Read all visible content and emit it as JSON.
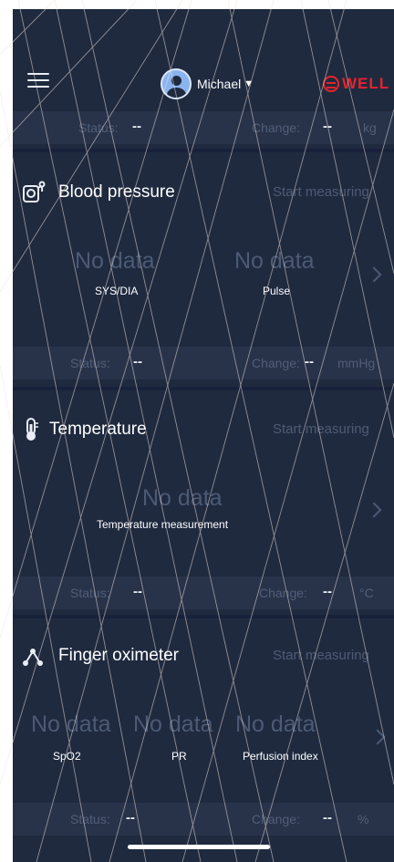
{
  "header": {
    "user_name": "Michael",
    "brand": "WELL",
    "icons": [
      "menu-icon",
      "avatar",
      "chevron-down-icon",
      "brand-logo"
    ]
  },
  "top_status": {
    "status_label": "Status:",
    "status_value": "--",
    "change_label": "Change:",
    "change_value": "--",
    "unit": "kg"
  },
  "blood_pressure": {
    "title": "Blood pressure",
    "action": "Start measuring",
    "metrics": [
      {
        "value": "No data",
        "label": "SYS/DIA"
      },
      {
        "value": "No data",
        "label": "Pulse"
      }
    ],
    "status_label": "Status:",
    "status_value": "--",
    "change_label": "Change:",
    "change_value": "--",
    "unit": "mmHg"
  },
  "temperature": {
    "title": "Temperature",
    "action": "Start measuring",
    "metrics": [
      {
        "value": "No data",
        "label": "Temperature measurement"
      }
    ],
    "status_label": "Status:",
    "status_value": "--",
    "change_label": "Change:",
    "change_value": "--",
    "unit": "°C"
  },
  "oximeter": {
    "title": "Finger oximeter",
    "action": "Start measuring",
    "metrics": [
      {
        "value": "No data",
        "label": "SpO2"
      },
      {
        "value": "No data",
        "label": "PR"
      },
      {
        "value": "No data",
        "label": "Perfusion index"
      }
    ],
    "status_label": "Status:",
    "status_value": "--",
    "change_label": "Change:",
    "change_value": "--",
    "unit": "%"
  },
  "colors": {
    "background": "#1f2a3f",
    "brand": "#e6232c",
    "muted": "#4d5a75"
  }
}
